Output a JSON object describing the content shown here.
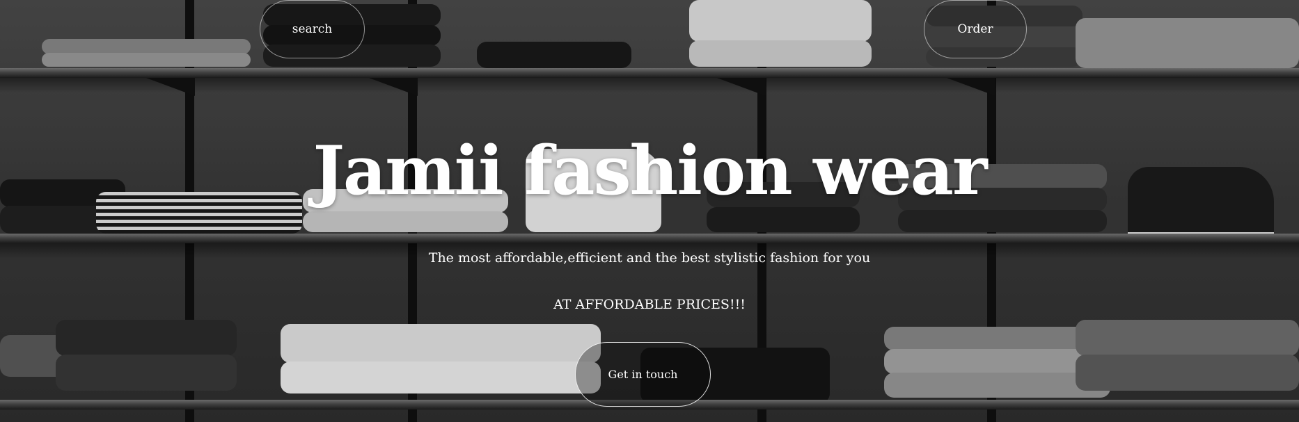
{
  "nav": {
    "search_label": "search",
    "order_label": "Order"
  },
  "hero": {
    "title": "Jamii fashion wear",
    "subtitle": "The most affordable,efficient and the best stylistic fashion for you",
    "tagline": "AT AFFORDABLE PRICES!!!",
    "cta_label": "Get in touch"
  },
  "colors": {
    "text": "#ffffff",
    "background_tone": "#3b3b3b",
    "shelf_dark": "#111111"
  }
}
